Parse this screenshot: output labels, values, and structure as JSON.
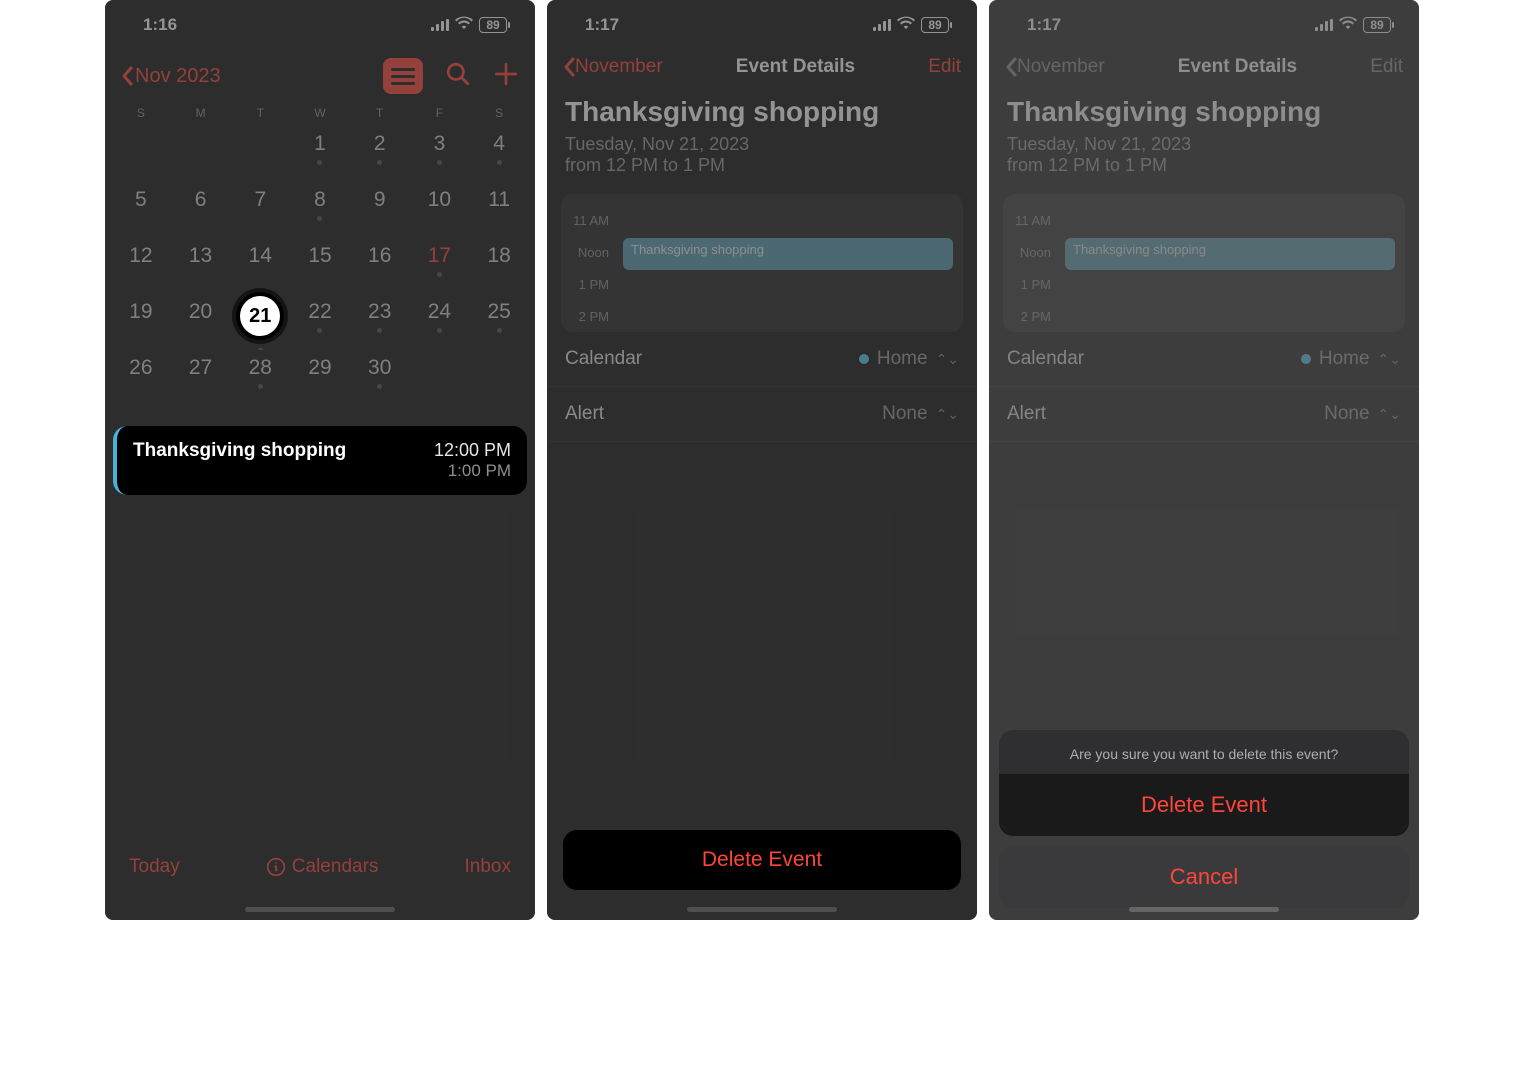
{
  "status": {
    "time1": "1:16",
    "time2": "1:17",
    "battery": "89"
  },
  "screen1": {
    "back_label": "Nov 2023",
    "weekdays": [
      "S",
      "M",
      "T",
      "W",
      "T",
      "F",
      "S"
    ],
    "days_leading_blank": 3,
    "days_in_month": 30,
    "days_with_dot": [
      1,
      2,
      3,
      4,
      8,
      17,
      21,
      22,
      23,
      24,
      25,
      28,
      30
    ],
    "red_day": 17,
    "selected_day": 21,
    "event": {
      "title": "Thanksgiving shopping",
      "start": "12:00 PM",
      "end": "1:00 PM"
    },
    "tab": {
      "today": "Today",
      "calendars": "Calendars",
      "inbox": "Inbox"
    }
  },
  "detail": {
    "back_label": "November",
    "header_title": "Event Details",
    "edit_label": "Edit",
    "title": "Thanksgiving shopping",
    "date": "Tuesday, Nov 21, 2023",
    "time": "from 12 PM to 1 PM",
    "hours": [
      "11 AM",
      "Noon",
      "1 PM",
      "2 PM"
    ],
    "block_label": "Thanksgiving shopping",
    "calendar_label": "Calendar",
    "calendar_value": "Home",
    "alert_label": "Alert",
    "alert_value": "None",
    "delete_label": "Delete Event"
  },
  "sheet": {
    "message": "Are you sure you want to delete this event?",
    "delete": "Delete Event",
    "cancel": "Cancel"
  }
}
